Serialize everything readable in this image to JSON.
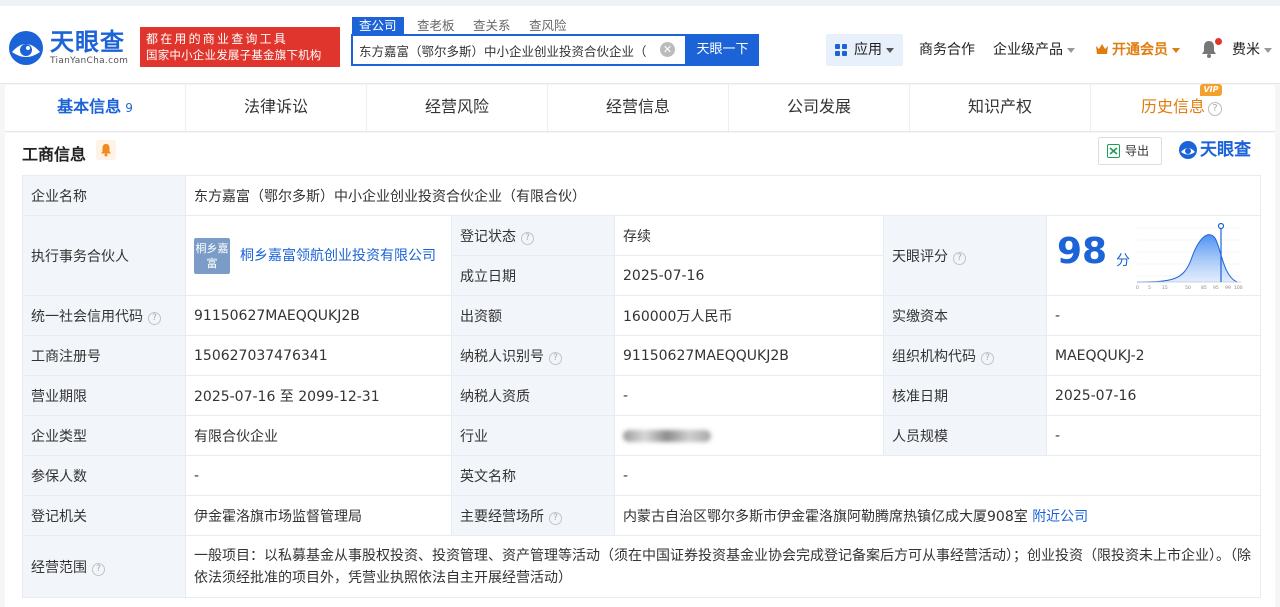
{
  "header": {
    "logo_text": "天眼查",
    "logo_sub": "TianYanCha.com",
    "slogan_line1": "都在用的商业查询工具",
    "slogan_line2": "国家中小企业发展子基金旗下机构",
    "search_tabs": [
      "查公司",
      "查老板",
      "查关系",
      "查风险"
    ],
    "search_value": "东方嘉富（鄂尔多斯）中小企业创业投资合伙企业（有",
    "search_button": "天眼一下",
    "apps_label": "应用",
    "business_coop": "商务合作",
    "enterprise_products": "企业级产品",
    "vip_label": "开通会员",
    "user_name": "费米"
  },
  "tabs": [
    {
      "label": "基本信息",
      "count": "9"
    },
    {
      "label": "法律诉讼"
    },
    {
      "label": "经营风险"
    },
    {
      "label": "经营信息"
    },
    {
      "label": "公司发展"
    },
    {
      "label": "知识产权"
    },
    {
      "label": "历史信息",
      "badge": "VIP"
    }
  ],
  "section": {
    "title": "工商信息",
    "export_label": "导出",
    "brand": "天眼查"
  },
  "info": {
    "company_name_label": "企业名称",
    "company_name": "东方嘉富（鄂尔多斯）中小企业创业投资合伙企业（有限合伙）",
    "partner_label": "执行事务合伙人",
    "partner_logo": "桐乡嘉富",
    "partner_name": "桐乡嘉富领航创业投资有限公司",
    "reg_status_label": "登记状态",
    "reg_status": "存续",
    "found_date_label": "成立日期",
    "found_date": "2025-07-16",
    "score_label": "天眼评分",
    "score": "98",
    "score_unit": "分",
    "score_axis": [
      "0",
      "5",
      "15",
      "50",
      "85",
      "95",
      "99",
      "100"
    ],
    "credit_code_label": "统一社会信用代码",
    "credit_code": "91150627MAEQQUKJ2B",
    "capital_label": "出资额",
    "capital": "160000万人民币",
    "paid_capital_label": "实缴资本",
    "paid_capital": "-",
    "reg_no_label": "工商注册号",
    "reg_no": "150627037476341",
    "taxpayer_id_label": "纳税人识别号",
    "taxpayer_id": "91150627MAEQQUKJ2B",
    "org_code_label": "组织机构代码",
    "org_code": "MAEQQUKJ-2",
    "term_label": "营业期限",
    "term": "2025-07-16 至 2099-12-31",
    "taxpayer_qual_label": "纳税人资质",
    "taxpayer_qual": "-",
    "approve_date_label": "核准日期",
    "approve_date": "2025-07-16",
    "type_label": "企业类型",
    "type": "有限合伙企业",
    "industry_label": "行业",
    "staff_size_label": "人员规模",
    "staff_size": "-",
    "insured_label": "参保人数",
    "insured": "-",
    "english_name_label": "英文名称",
    "english_name": "-",
    "authority_label": "登记机关",
    "authority": "伊金霍洛旗市场监督管理局",
    "address_label": "主要经营场所",
    "address": "内蒙古自治区鄂尔多斯市伊金霍洛旗阿勒腾席热镇亿成大厦908室",
    "nearby_link": "附近公司",
    "scope_label": "经营范围",
    "scope": "一般项目：以私募基金从事股权投资、投资管理、资产管理等活动（须在中国证券投资基金业协会完成登记备案后方可从事经营活动）；创业投资（限投资未上市企业）。（除依法须经批准的项目外，凭营业执照依法自主开展经营活动）"
  },
  "colors": {
    "brand_blue": "#1c63d8",
    "slogan_red": "#e0352c",
    "vip_orange": "#e07d10",
    "status_green": "#1aa56d"
  }
}
